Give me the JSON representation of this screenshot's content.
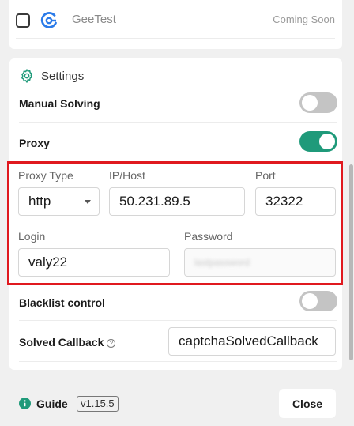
{
  "captcha_list": {
    "item": {
      "label": "GeeTest",
      "status": "Coming Soon",
      "checked": false
    }
  },
  "settings": {
    "title": "Settings",
    "manual_solving": {
      "label": "Manual Solving",
      "enabled": false
    },
    "proxy": {
      "label": "Proxy",
      "enabled": true,
      "type_label": "Proxy Type",
      "type_value": "http",
      "host_label": "IP/Host",
      "host_value": "50.231.89.5",
      "port_label": "Port",
      "port_value": "32322",
      "login_label": "Login",
      "login_value": "valy22",
      "password_label": "Password",
      "password_value": "lastpassword"
    },
    "blacklist": {
      "label": "Blacklist control",
      "enabled": false
    },
    "solved_callback": {
      "label": "Solved Callback",
      "help": "?",
      "value": "captchaSolvedCallback"
    }
  },
  "footer": {
    "guide_label": "Guide",
    "version": "v1.15.5",
    "close_label": "Close"
  },
  "colors": {
    "accent": "#1f9a7a",
    "toggle_off": "#c4c4c4",
    "highlight": "#e0191f",
    "brand_geetest": "#2b7be9"
  }
}
